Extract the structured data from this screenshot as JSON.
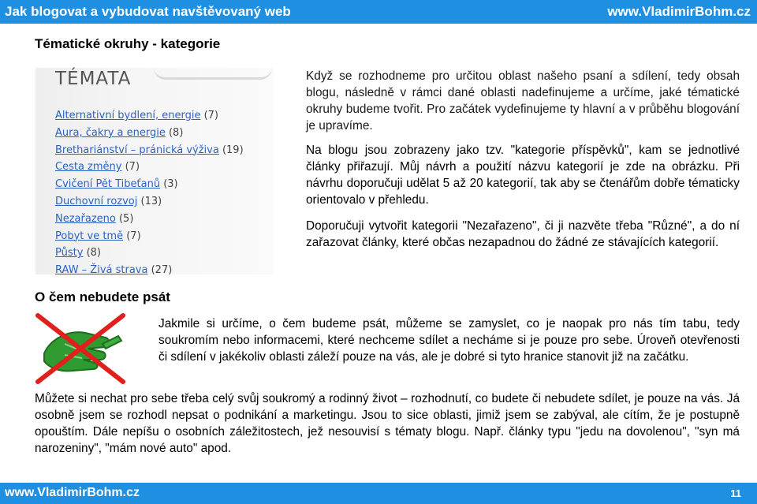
{
  "header": {
    "title": "Jak blogovat a vybudovat navštěvovaný web",
    "site": "www.VladimirBohm.cz"
  },
  "section1": {
    "heading": "Tématické okruhy - kategorie",
    "image": {
      "title": "TÉMATA",
      "items": [
        {
          "label": "Alternativní bydlení, energie",
          "count": "(7)"
        },
        {
          "label": "Aura, čakry a energie",
          "count": "(8)"
        },
        {
          "label": "Brethariánství – pránická výživa",
          "count": "(19)"
        },
        {
          "label": "Cesta změny",
          "count": "(7)"
        },
        {
          "label": "Cvičení Pět Tibeťanů",
          "count": "(3)"
        },
        {
          "label": "Duchovní rozvoj",
          "count": "(13)"
        },
        {
          "label": "Nezařazeno",
          "count": "(5)"
        },
        {
          "label": "Pobyt ve tmě",
          "count": "(7)"
        },
        {
          "label": "Půsty",
          "count": "(8)"
        },
        {
          "label": "RAW – Živá strava",
          "count": "(27)"
        }
      ]
    },
    "paragraphs": [
      "Když se rozhodneme pro určitou oblast našeho psaní a sdílení, tedy obsah blogu, následně v rámci dané oblasti nadefinujeme a určíme, jaké tématické okruhy budeme tvořit. Pro začátek vydefinujeme ty hlavní a v průběhu blogování je upravíme.",
      "Na blogu jsou zobrazeny jako tzv. \"kategorie příspěvků\", kam se jednotlivé články přiřazují. Můj návrh a použití názvu kategorií je zde na obrázku. Při návrhu doporučuji udělat 5 až 20 kategorií, tak aby se čtenářům dobře tématicky orientovalo v přehledu.",
      "Doporučuji vytvořit kategorii \"Nezařazeno\", či ji nazvěte třeba \"Různé\", a do ní zařazovat články, které občas nezapadnou do žádné ze stávajících kategorií."
    ]
  },
  "section2": {
    "heading": "O čem nebudete psát",
    "icon": "crossed-out-writing-hand-icon",
    "paragraph1": "Jakmile si určíme, o čem budeme psát, můžeme se zamyslet, co je naopak pro nás tím tabu, tedy soukromím nebo informacemi, které nechceme sdílet a necháme si je pouze pro sebe. Úroveň otevřenosti či sdílení v jakékoliv oblasti záleží pouze na vás, ale je dobré si tyto hranice stanovit již na začátku.",
    "paragraph2": "Můžete si nechat pro sebe třeba celý svůj soukromý a rodinný život – rozhodnutí, co budete či nebudete sdílet, je pouze na vás. Já osobně jsem se rozhodl nepsat o podnikání a marketingu. Jsou to sice oblasti, jimiž jsem se zabýval, ale cítím, že je postupně opouštím. Dále nepíšu o osobních záležitostech, jež nesouvisí s tématy blogu. Např. články typu \"jedu na dovolenou\", \"syn má narozeniny\", \"mám nové auto\" apod."
  },
  "footer": {
    "site": "www.VladimirBohm.cz",
    "page_number": "11"
  },
  "colors": {
    "bar": "#1f8fe2",
    "link": "#2a62c4",
    "ban_red": "#e0201c",
    "hand_green": "#2f9a2f"
  }
}
